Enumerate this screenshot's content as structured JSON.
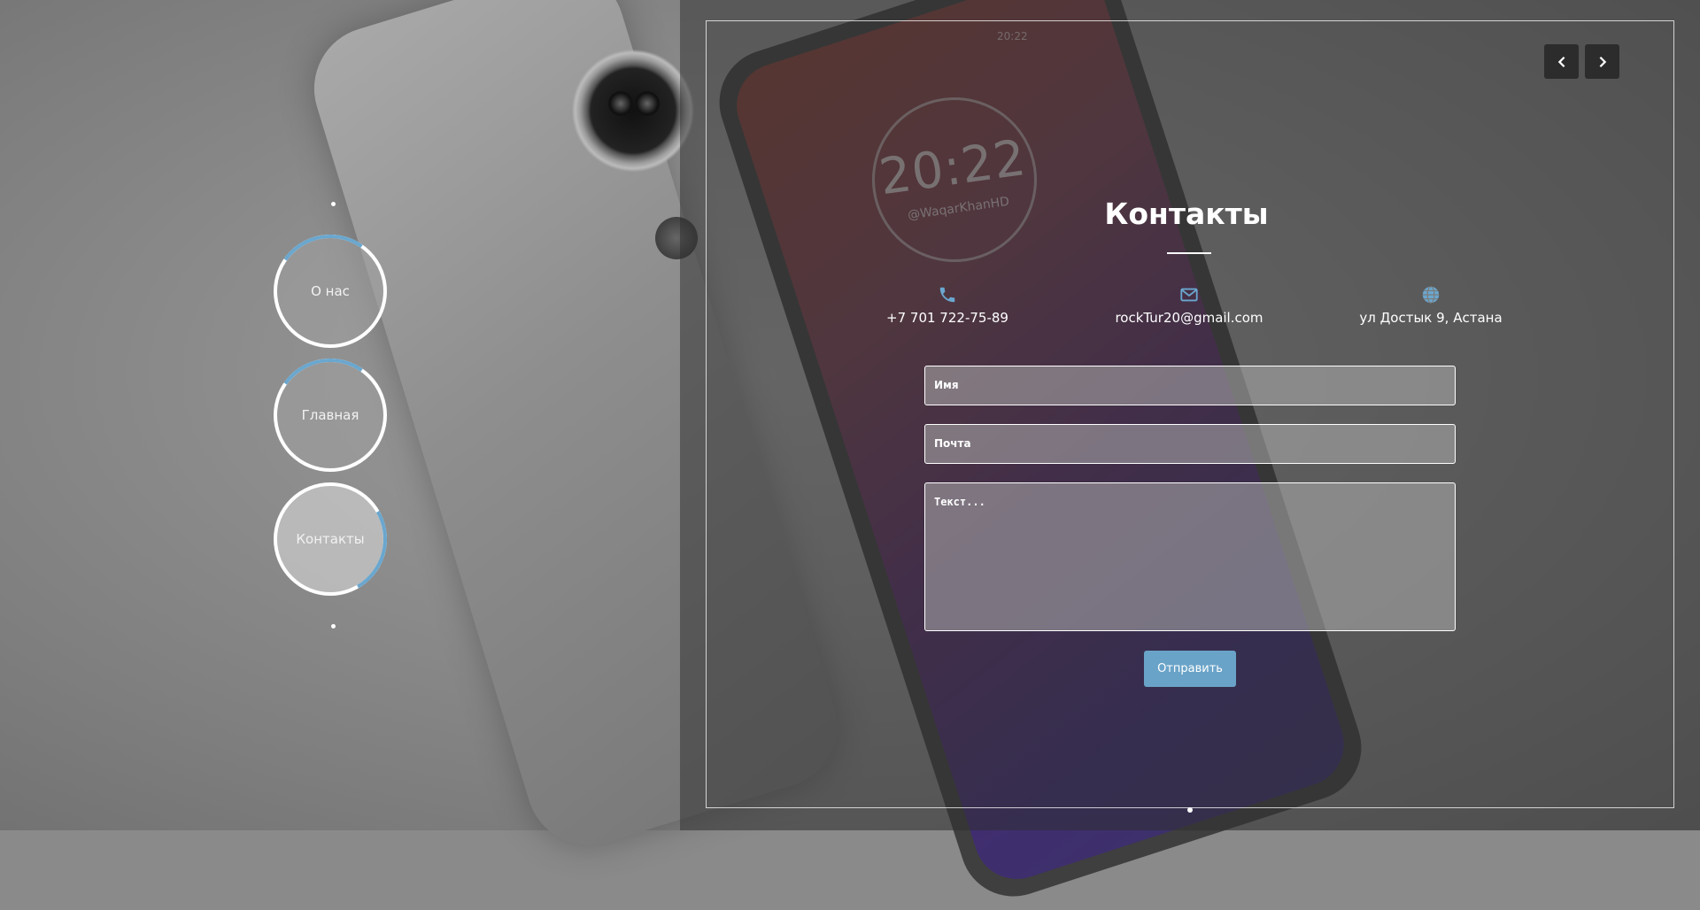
{
  "nav": {
    "items": [
      {
        "label": "О нас",
        "active": false
      },
      {
        "label": "Главная",
        "active": false
      },
      {
        "label": "Контакты",
        "active": true
      }
    ],
    "accent_color": "#6aa7cf"
  },
  "slider": {
    "prev_icon": "chevron-left-icon",
    "next_icon": "chevron-right-icon"
  },
  "background": {
    "clock_time": "20:22",
    "clock_handle": "@WaqarKhanHD",
    "status_time": "20:22"
  },
  "contacts": {
    "title": "Контакты",
    "phone": {
      "icon": "phone-icon",
      "text": "+7 701 722-75-89"
    },
    "email": {
      "icon": "envelope-icon",
      "text": "rockTur20@gmail.com"
    },
    "address": {
      "icon": "globe-icon",
      "text": "ул Достык 9, Астана"
    },
    "icon_color": "#6aa7cf"
  },
  "form": {
    "name_placeholder": "Имя",
    "email_placeholder": "Почта",
    "text_placeholder": "Текст...",
    "submit_label": "Отправить",
    "submit_color": "#6aa3c8"
  }
}
